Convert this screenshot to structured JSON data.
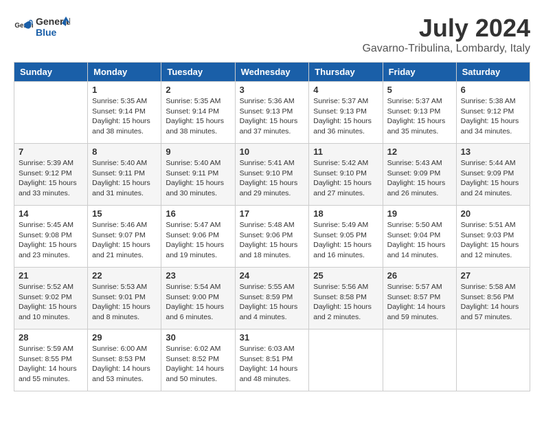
{
  "header": {
    "logo_line1": "General",
    "logo_line2": "Blue",
    "month": "July 2024",
    "location": "Gavarno-Tribulina, Lombardy, Italy"
  },
  "weekdays": [
    "Sunday",
    "Monday",
    "Tuesday",
    "Wednesday",
    "Thursday",
    "Friday",
    "Saturday"
  ],
  "weeks": [
    [
      {
        "day": "",
        "sunrise": "",
        "sunset": "",
        "daylight": ""
      },
      {
        "day": "1",
        "sunrise": "Sunrise: 5:35 AM",
        "sunset": "Sunset: 9:14 PM",
        "daylight": "Daylight: 15 hours and 38 minutes."
      },
      {
        "day": "2",
        "sunrise": "Sunrise: 5:35 AM",
        "sunset": "Sunset: 9:14 PM",
        "daylight": "Daylight: 15 hours and 38 minutes."
      },
      {
        "day": "3",
        "sunrise": "Sunrise: 5:36 AM",
        "sunset": "Sunset: 9:13 PM",
        "daylight": "Daylight: 15 hours and 37 minutes."
      },
      {
        "day": "4",
        "sunrise": "Sunrise: 5:37 AM",
        "sunset": "Sunset: 9:13 PM",
        "daylight": "Daylight: 15 hours and 36 minutes."
      },
      {
        "day": "5",
        "sunrise": "Sunrise: 5:37 AM",
        "sunset": "Sunset: 9:13 PM",
        "daylight": "Daylight: 15 hours and 35 minutes."
      },
      {
        "day": "6",
        "sunrise": "Sunrise: 5:38 AM",
        "sunset": "Sunset: 9:12 PM",
        "daylight": "Daylight: 15 hours and 34 minutes."
      }
    ],
    [
      {
        "day": "7",
        "sunrise": "Sunrise: 5:39 AM",
        "sunset": "Sunset: 9:12 PM",
        "daylight": "Daylight: 15 hours and 33 minutes."
      },
      {
        "day": "8",
        "sunrise": "Sunrise: 5:40 AM",
        "sunset": "Sunset: 9:11 PM",
        "daylight": "Daylight: 15 hours and 31 minutes."
      },
      {
        "day": "9",
        "sunrise": "Sunrise: 5:40 AM",
        "sunset": "Sunset: 9:11 PM",
        "daylight": "Daylight: 15 hours and 30 minutes."
      },
      {
        "day": "10",
        "sunrise": "Sunrise: 5:41 AM",
        "sunset": "Sunset: 9:10 PM",
        "daylight": "Daylight: 15 hours and 29 minutes."
      },
      {
        "day": "11",
        "sunrise": "Sunrise: 5:42 AM",
        "sunset": "Sunset: 9:10 PM",
        "daylight": "Daylight: 15 hours and 27 minutes."
      },
      {
        "day": "12",
        "sunrise": "Sunrise: 5:43 AM",
        "sunset": "Sunset: 9:09 PM",
        "daylight": "Daylight: 15 hours and 26 minutes."
      },
      {
        "day": "13",
        "sunrise": "Sunrise: 5:44 AM",
        "sunset": "Sunset: 9:09 PM",
        "daylight": "Daylight: 15 hours and 24 minutes."
      }
    ],
    [
      {
        "day": "14",
        "sunrise": "Sunrise: 5:45 AM",
        "sunset": "Sunset: 9:08 PM",
        "daylight": "Daylight: 15 hours and 23 minutes."
      },
      {
        "day": "15",
        "sunrise": "Sunrise: 5:46 AM",
        "sunset": "Sunset: 9:07 PM",
        "daylight": "Daylight: 15 hours and 21 minutes."
      },
      {
        "day": "16",
        "sunrise": "Sunrise: 5:47 AM",
        "sunset": "Sunset: 9:06 PM",
        "daylight": "Daylight: 15 hours and 19 minutes."
      },
      {
        "day": "17",
        "sunrise": "Sunrise: 5:48 AM",
        "sunset": "Sunset: 9:06 PM",
        "daylight": "Daylight: 15 hours and 18 minutes."
      },
      {
        "day": "18",
        "sunrise": "Sunrise: 5:49 AM",
        "sunset": "Sunset: 9:05 PM",
        "daylight": "Daylight: 15 hours and 16 minutes."
      },
      {
        "day": "19",
        "sunrise": "Sunrise: 5:50 AM",
        "sunset": "Sunset: 9:04 PM",
        "daylight": "Daylight: 15 hours and 14 minutes."
      },
      {
        "day": "20",
        "sunrise": "Sunrise: 5:51 AM",
        "sunset": "Sunset: 9:03 PM",
        "daylight": "Daylight: 15 hours and 12 minutes."
      }
    ],
    [
      {
        "day": "21",
        "sunrise": "Sunrise: 5:52 AM",
        "sunset": "Sunset: 9:02 PM",
        "daylight": "Daylight: 15 hours and 10 minutes."
      },
      {
        "day": "22",
        "sunrise": "Sunrise: 5:53 AM",
        "sunset": "Sunset: 9:01 PM",
        "daylight": "Daylight: 15 hours and 8 minutes."
      },
      {
        "day": "23",
        "sunrise": "Sunrise: 5:54 AM",
        "sunset": "Sunset: 9:00 PM",
        "daylight": "Daylight: 15 hours and 6 minutes."
      },
      {
        "day": "24",
        "sunrise": "Sunrise: 5:55 AM",
        "sunset": "Sunset: 8:59 PM",
        "daylight": "Daylight: 15 hours and 4 minutes."
      },
      {
        "day": "25",
        "sunrise": "Sunrise: 5:56 AM",
        "sunset": "Sunset: 8:58 PM",
        "daylight": "Daylight: 15 hours and 2 minutes."
      },
      {
        "day": "26",
        "sunrise": "Sunrise: 5:57 AM",
        "sunset": "Sunset: 8:57 PM",
        "daylight": "Daylight: 14 hours and 59 minutes."
      },
      {
        "day": "27",
        "sunrise": "Sunrise: 5:58 AM",
        "sunset": "Sunset: 8:56 PM",
        "daylight": "Daylight: 14 hours and 57 minutes."
      }
    ],
    [
      {
        "day": "28",
        "sunrise": "Sunrise: 5:59 AM",
        "sunset": "Sunset: 8:55 PM",
        "daylight": "Daylight: 14 hours and 55 minutes."
      },
      {
        "day": "29",
        "sunrise": "Sunrise: 6:00 AM",
        "sunset": "Sunset: 8:53 PM",
        "daylight": "Daylight: 14 hours and 53 minutes."
      },
      {
        "day": "30",
        "sunrise": "Sunrise: 6:02 AM",
        "sunset": "Sunset: 8:52 PM",
        "daylight": "Daylight: 14 hours and 50 minutes."
      },
      {
        "day": "31",
        "sunrise": "Sunrise: 6:03 AM",
        "sunset": "Sunset: 8:51 PM",
        "daylight": "Daylight: 14 hours and 48 minutes."
      },
      {
        "day": "",
        "sunrise": "",
        "sunset": "",
        "daylight": ""
      },
      {
        "day": "",
        "sunrise": "",
        "sunset": "",
        "daylight": ""
      },
      {
        "day": "",
        "sunrise": "",
        "sunset": "",
        "daylight": ""
      }
    ]
  ]
}
